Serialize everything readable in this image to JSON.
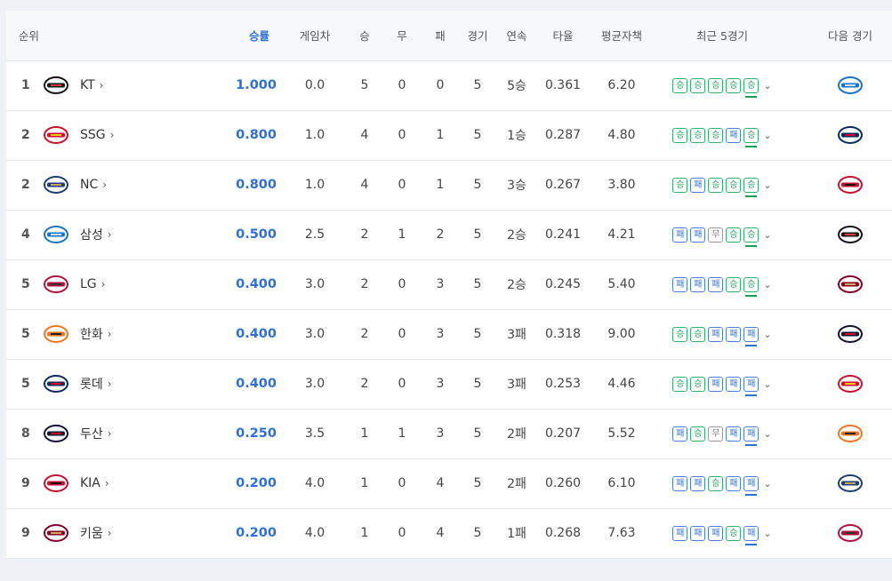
{
  "headers": {
    "rank": "순위",
    "win_pct": "승률",
    "games_behind": "게임차",
    "wins": "승",
    "draws": "무",
    "losses": "패",
    "games": "경기",
    "streak": "연속",
    "batting_avg": "타율",
    "era": "평균자책",
    "recent5": "최근 5경기",
    "next_game": "다음 경기"
  },
  "colors": {
    "accent": "#2f6fd6",
    "win": "#1f9c57",
    "loss": "#2f6fd6",
    "draw": "#777777"
  },
  "rows": [
    {
      "rank": "1",
      "team": "KT",
      "logo": "kt-wiz-logo",
      "pct": "1.000",
      "gb": "0.0",
      "w": "5",
      "d": "0",
      "l": "0",
      "g": "5",
      "streak": "5승",
      "avg": "0.361",
      "era": "6.20",
      "recent": [
        "승",
        "승",
        "승",
        "승",
        "승"
      ],
      "next": "samsung-lions-logo"
    },
    {
      "rank": "2",
      "team": "SSG",
      "logo": "ssg-landers-logo",
      "pct": "0.800",
      "gb": "1.0",
      "w": "4",
      "d": "0",
      "l": "1",
      "g": "5",
      "streak": "1승",
      "avg": "0.287",
      "era": "4.80",
      "recent": [
        "승",
        "승",
        "승",
        "패",
        "승"
      ],
      "next": "lotte-giants-logo"
    },
    {
      "rank": "2",
      "team": "NC",
      "logo": "nc-dinos-logo",
      "pct": "0.800",
      "gb": "1.0",
      "w": "4",
      "d": "0",
      "l": "1",
      "g": "5",
      "streak": "3승",
      "avg": "0.267",
      "era": "3.80",
      "recent": [
        "승",
        "패",
        "승",
        "승",
        "승"
      ],
      "next": "kia-tigers-logo"
    },
    {
      "rank": "4",
      "team": "삼성",
      "logo": "samsung-lions-logo",
      "pct": "0.500",
      "gb": "2.5",
      "w": "2",
      "d": "1",
      "l": "2",
      "g": "5",
      "streak": "2승",
      "avg": "0.241",
      "era": "4.21",
      "recent": [
        "패",
        "패",
        "무",
        "승",
        "승"
      ],
      "next": "kt-wiz-logo"
    },
    {
      "rank": "5",
      "team": "LG",
      "logo": "lg-twins-logo",
      "pct": "0.400",
      "gb": "3.0",
      "w": "2",
      "d": "0",
      "l": "3",
      "g": "5",
      "streak": "2승",
      "avg": "0.245",
      "era": "5.40",
      "recent": [
        "패",
        "패",
        "패",
        "승",
        "승"
      ],
      "next": "kiwoom-heroes-logo"
    },
    {
      "rank": "5",
      "team": "한화",
      "logo": "hanwha-eagles-logo",
      "pct": "0.400",
      "gb": "3.0",
      "w": "2",
      "d": "0",
      "l": "3",
      "g": "5",
      "streak": "3패",
      "avg": "0.318",
      "era": "9.00",
      "recent": [
        "승",
        "승",
        "패",
        "패",
        "패"
      ],
      "next": "doosan-bears-logo"
    },
    {
      "rank": "5",
      "team": "롯데",
      "logo": "lotte-giants-logo",
      "pct": "0.400",
      "gb": "3.0",
      "w": "2",
      "d": "0",
      "l": "3",
      "g": "5",
      "streak": "3패",
      "avg": "0.253",
      "era": "4.46",
      "recent": [
        "승",
        "승",
        "패",
        "패",
        "패"
      ],
      "next": "ssg-landers-logo"
    },
    {
      "rank": "8",
      "team": "두산",
      "logo": "doosan-bears-logo",
      "pct": "0.250",
      "gb": "3.5",
      "w": "1",
      "d": "1",
      "l": "3",
      "g": "5",
      "streak": "2패",
      "avg": "0.207",
      "era": "5.52",
      "recent": [
        "패",
        "승",
        "무",
        "패",
        "패"
      ],
      "next": "hanwha-eagles-logo"
    },
    {
      "rank": "9",
      "team": "KIA",
      "logo": "kia-tigers-logo",
      "pct": "0.200",
      "gb": "4.0",
      "w": "1",
      "d": "0",
      "l": "4",
      "g": "5",
      "streak": "2패",
      "avg": "0.260",
      "era": "6.10",
      "recent": [
        "패",
        "패",
        "승",
        "패",
        "패"
      ],
      "next": "nc-dinos-logo"
    },
    {
      "rank": "9",
      "team": "키움",
      "logo": "kiwoom-heroes-logo",
      "pct": "0.200",
      "gb": "4.0",
      "w": "1",
      "d": "0",
      "l": "4",
      "g": "5",
      "streak": "1패",
      "avg": "0.268",
      "era": "7.63",
      "recent": [
        "패",
        "패",
        "패",
        "승",
        "패"
      ],
      "next": "lg-twins-logo"
    }
  ]
}
